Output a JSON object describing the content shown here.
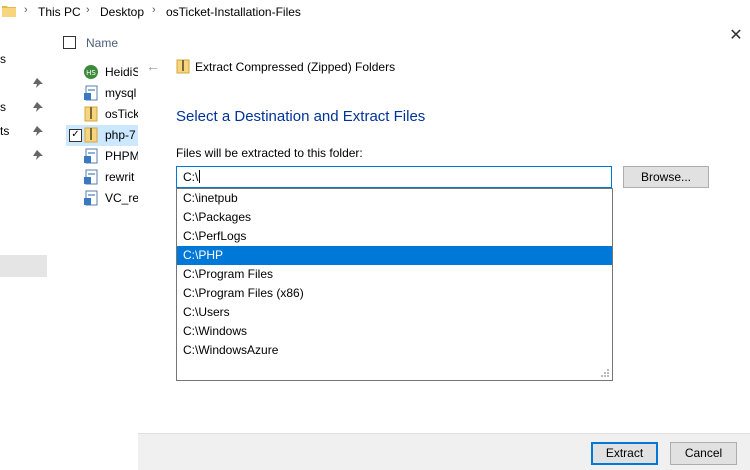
{
  "breadcrumb": {
    "items": [
      "This PC",
      "Desktop",
      "osTicket-Installation-Files"
    ],
    "separator": "›"
  },
  "nav_fragments": [
    "s",
    "s",
    "ts"
  ],
  "file_list": {
    "header_name": "Name",
    "items": [
      {
        "label": "HeidiS",
        "icon": "heidisql-icon",
        "selected": false
      },
      {
        "label": "mysql",
        "icon": "installer-icon",
        "selected": false
      },
      {
        "label": "osTick",
        "icon": "zip-folder-icon",
        "selected": false
      },
      {
        "label": "php-7",
        "icon": "zip-folder-icon",
        "selected": true
      },
      {
        "label": "PHPM",
        "icon": "installer-icon",
        "selected": false
      },
      {
        "label": "rewrit",
        "icon": "installer-icon",
        "selected": false
      },
      {
        "label": "VC_re",
        "icon": "installer-icon",
        "selected": false
      }
    ]
  },
  "wizard": {
    "title": "Extract Compressed (Zipped) Folders",
    "heading": "Select a Destination and Extract Files",
    "dest_label": "Files will be extracted to this folder:",
    "path_value": "C:\\",
    "browse_label": "Browse...",
    "suggestions": [
      "C:\\inetpub",
      "C:\\Packages",
      "C:\\PerfLogs",
      "C:\\PHP",
      "C:\\Program Files",
      "C:\\Program Files (x86)",
      "C:\\Users",
      "C:\\Windows",
      "C:\\WindowsAzure"
    ],
    "selected_suggestion": "C:\\PHP",
    "extract_label": "Extract",
    "cancel_label": "Cancel",
    "close_glyph": "✕"
  },
  "colors": {
    "accent": "#0078d7",
    "heading": "#003399",
    "selection_light": "#cce8ff",
    "footer_bg": "#f0f0f0"
  }
}
